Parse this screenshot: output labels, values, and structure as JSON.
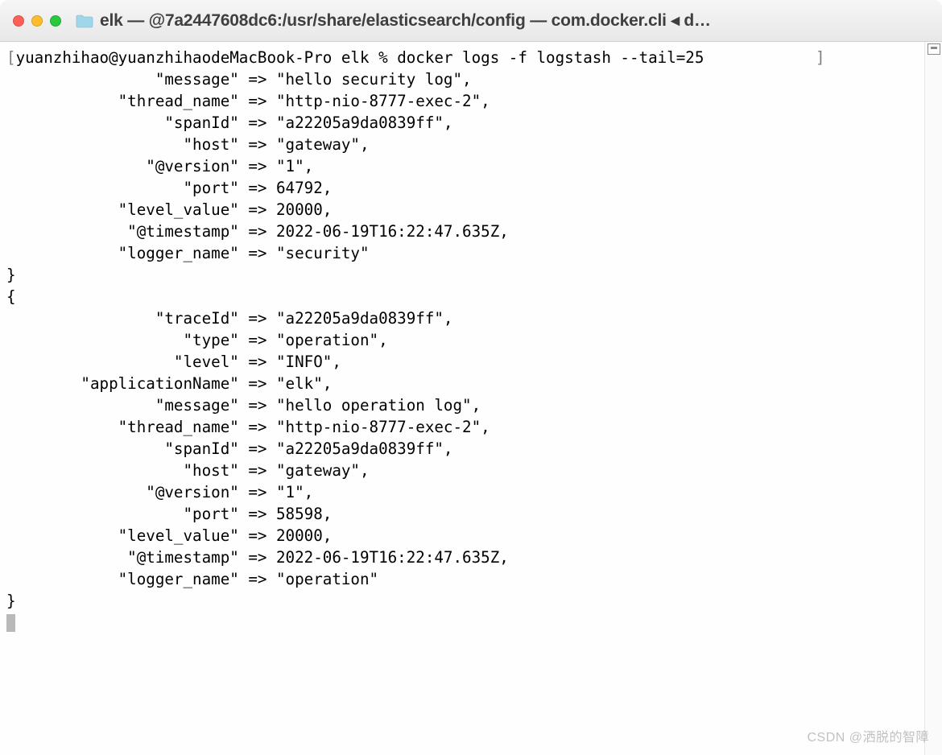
{
  "window": {
    "title": "elk — @7a2447608dc6:/usr/share/elasticsearch/config — com.docker.cli ◂ d…"
  },
  "prompt": {
    "open_bracket": "[",
    "user_host_path": "yuanzhihao@yuanzhihaodeMacBook-Pro elk % ",
    "command": "docker logs -f logstash --tail=25",
    "close_bracket": "]"
  },
  "log1": {
    "end_brace": "}",
    "fields": [
      {
        "key": "\"message\"",
        "arrow": "=>",
        "val": "\"hello security log\","
      },
      {
        "key": "\"thread_name\"",
        "arrow": "=>",
        "val": "\"http-nio-8777-exec-2\","
      },
      {
        "key": "\"spanId\"",
        "arrow": "=>",
        "val": "\"a22205a9da0839ff\","
      },
      {
        "key": "\"host\"",
        "arrow": "=>",
        "val": "\"gateway\","
      },
      {
        "key": "\"@version\"",
        "arrow": "=>",
        "val": "\"1\","
      },
      {
        "key": "\"port\"",
        "arrow": "=>",
        "val": "64792,"
      },
      {
        "key": "\"level_value\"",
        "arrow": "=>",
        "val": "20000,"
      },
      {
        "key": "\"@timestamp\"",
        "arrow": "=>",
        "val": "2022-06-19T16:22:47.635Z,"
      },
      {
        "key": "\"logger_name\"",
        "arrow": "=>",
        "val": "\"security\""
      }
    ]
  },
  "log2": {
    "open_brace": "{",
    "end_brace": "}",
    "fields": [
      {
        "key": "\"traceId\"",
        "arrow": "=>",
        "val": "\"a22205a9da0839ff\","
      },
      {
        "key": "\"type\"",
        "arrow": "=>",
        "val": "\"operation\","
      },
      {
        "key": "\"level\"",
        "arrow": "=>",
        "val": "\"INFO\","
      },
      {
        "key": "\"applicationName\"",
        "arrow": "=>",
        "val": "\"elk\","
      },
      {
        "key": "\"message\"",
        "arrow": "=>",
        "val": "\"hello operation log\","
      },
      {
        "key": "\"thread_name\"",
        "arrow": "=>",
        "val": "\"http-nio-8777-exec-2\","
      },
      {
        "key": "\"spanId\"",
        "arrow": "=>",
        "val": "\"a22205a9da0839ff\","
      },
      {
        "key": "\"host\"",
        "arrow": "=>",
        "val": "\"gateway\","
      },
      {
        "key": "\"@version\"",
        "arrow": "=>",
        "val": "\"1\","
      },
      {
        "key": "\"port\"",
        "arrow": "=>",
        "val": "58598,"
      },
      {
        "key": "\"level_value\"",
        "arrow": "=>",
        "val": "20000,"
      },
      {
        "key": "\"@timestamp\"",
        "arrow": "=>",
        "val": "2022-06-19T16:22:47.635Z,"
      },
      {
        "key": "\"logger_name\"",
        "arrow": "=>",
        "val": "\"operation\""
      }
    ]
  },
  "watermark": "CSDN @洒脱的智障"
}
